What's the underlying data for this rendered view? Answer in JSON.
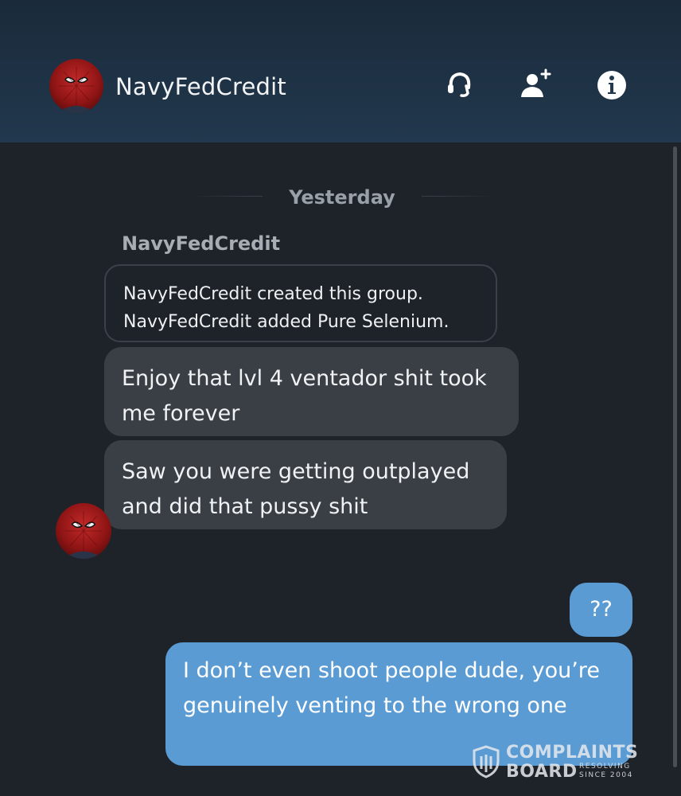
{
  "header": {
    "title": "NavyFedCredit",
    "icons": [
      "headset-icon",
      "add-user-icon",
      "info-icon"
    ]
  },
  "conversation": {
    "date_label": "Yesterday",
    "sender_name": "NavyFedCredit",
    "system_lines": [
      "NavyFedCredit created this group.",
      "NavyFedCredit added Pure Selenium."
    ],
    "incoming": [
      "Enjoy that lvl 4 ventador shit took me forever",
      "Saw you were getting outplayed and did that pussy shit"
    ],
    "outgoing": [
      "??",
      "I don’t even shoot people dude, you’re genuinely venting to the wrong one"
    ]
  },
  "watermark": {
    "line1": "COMPLAINTS",
    "line2": "BOARD",
    "side1": "RESOLVING",
    "side2": "SINCE 2004"
  },
  "colors": {
    "background": "#1e2329",
    "header": "#22384e",
    "incoming_bubble": "#3a3f46",
    "outgoing_bubble": "#5a9bd4"
  }
}
